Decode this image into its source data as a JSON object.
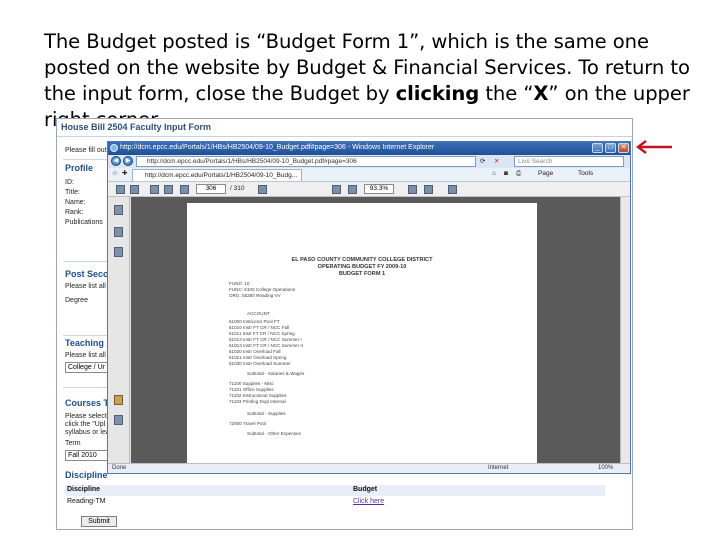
{
  "caption": {
    "pre": "The Budget posted is “Budget Form 1”, which is the same one posted on the website by Budget & Financial Services.  To return to the input form, close the Budget by ",
    "bold": "clicking",
    "mid": " the “",
    "bold2": "X",
    "post": "” on the upper right corner."
  },
  "form": {
    "header": "House Bill 2504 Faculty Input Form",
    "notice": "Please fill out",
    "profile": "Profile",
    "fields": [
      "ID:",
      "Title:",
      "Name:",
      "Rank:",
      "Publications"
    ],
    "post_sec": "Post Seco",
    "post_sec_text": "Please list all",
    "degree": "Degree",
    "teaching": "Teaching I",
    "teaching_text": "Please list all",
    "college": "College / Ur",
    "courses": "Courses T",
    "courses_text": [
      "Please select",
      "click the \"Upl",
      "syllabus or lea"
    ],
    "term": "Term",
    "term_value": "Fall 2010",
    "discipline_head": "Discipline",
    "table_head": {
      "discipline": "Discipline",
      "budget": "Budget"
    },
    "table_row": {
      "discipline": "Reading-TM",
      "budget": "Click here"
    },
    "submit": "Submit"
  },
  "ie": {
    "title": "http://dcm.epcc.edu/Portals/1/HBs/HB2504/09-10_Budget.pdf#page=306 - Windows Internet Explorer",
    "address": "http://dcm.epcc.edu/Portals/1/HBs/HB2504/09-10_Budget.pdf#page=306",
    "search_placeholder": "Live Search",
    "tab": "http://dcm.epcc.edu/Portals/1/HB2504/09-10_Budg...",
    "tools": [
      "Page",
      "Tools"
    ],
    "page_number": "306",
    "page_total": "/ 310",
    "zoom": "93.3%",
    "status_left": "Done",
    "status_right": "Internet",
    "zoom_status": "100%"
  },
  "pdf": {
    "title1": "EL PASO COUNTY COMMUNITY COLLEGE DISTRICT",
    "title2": "OPERATING BUDGET FY 2009-10",
    "title3": "BUDGET FORM 1",
    "lines": [
      "FUND:  10",
      "FUNC:  6100    College Operations",
      "ORG:   55280   Reading VV",
      "ACCOUNT",
      "61000  Instructor Pool FT",
      "61010  Instr FT CR / NCC Fall",
      "61011  Instr FT CR / NCC Spring",
      "61012  Instr FT CR / NCC Summer I",
      "61013  Instr FT CR / NCC Summer II",
      "61020  Instr Overload Fall",
      "61021  Instr Overload Spring",
      "61030  Instr Overload Summer",
      "Subtotal - Salaries & Wages",
      "71100  Supplies - Misc",
      "71101  Office Supplies",
      "71102  Instructional Supplies",
      "71103  Printing Dupl Internal",
      "Subtotal - Supplies",
      "72000  Travel Pool",
      "Subtotal - Other Expenses"
    ]
  }
}
